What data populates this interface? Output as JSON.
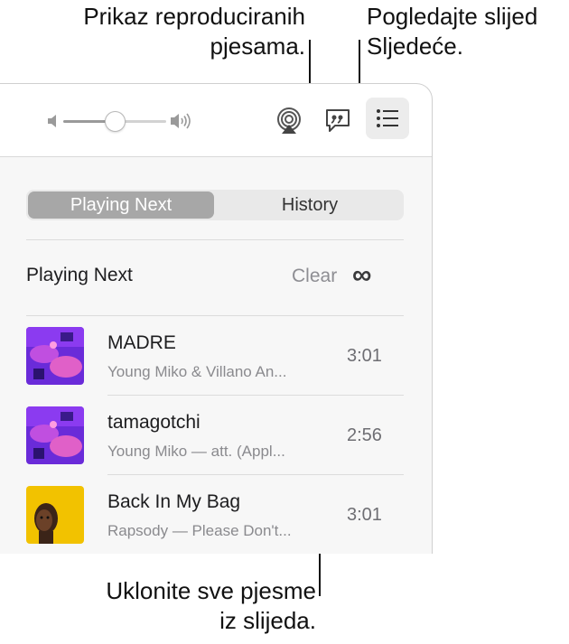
{
  "callouts": {
    "played": [
      "Prikaz reproduciranih",
      "pjesama."
    ],
    "queue": [
      "Pogledajte slijed",
      "Sljedeće."
    ],
    "clear": [
      "Uklonite sve pjesme",
      "iz slijeda."
    ]
  },
  "toolbar": {
    "volume_level": 0.5,
    "icons": [
      "volume-low-icon",
      "volume-high-icon",
      "airplay-icon",
      "lyrics-icon",
      "queue-list-icon"
    ]
  },
  "segmented": {
    "tabs": [
      {
        "label": "Playing Next",
        "selected": true
      },
      {
        "label": "History",
        "selected": false
      }
    ]
  },
  "queue": {
    "title": "Playing Next",
    "clear_label": "Clear",
    "autoplay_symbol": "∞",
    "songs": [
      {
        "title": "MADRE",
        "artist": "Young Miko & Villano An...",
        "duration": "3:01"
      },
      {
        "title": "tamagotchi",
        "artist": "Young Miko — att. (Appl...",
        "duration": "2:56"
      },
      {
        "title": "Back In My Bag",
        "artist": "Rapsody — Please Don't...",
        "duration": "3:01"
      }
    ]
  },
  "colors": {
    "selected_segment": "#a7a7a7",
    "pane_background": "#f7f7f7",
    "secondary_text": "#8a8a8e"
  }
}
